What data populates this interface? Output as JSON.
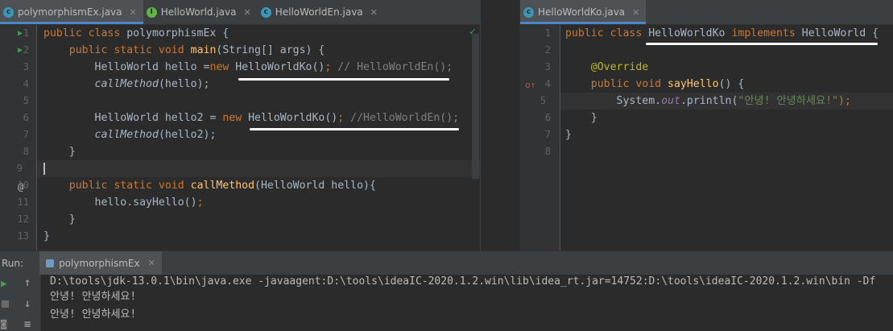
{
  "left_tabs": [
    {
      "label": "polymorphismEx.java",
      "icon": "class-icon",
      "active": true
    },
    {
      "label": "HelloWorld.java",
      "icon": "interface-icon",
      "active": false
    },
    {
      "label": "HelloWorldEn.java",
      "icon": "class-icon",
      "active": false
    }
  ],
  "right_tabs": [
    {
      "label": "HelloWorldKo.java",
      "icon": "class-icon",
      "active": true
    }
  ],
  "left_code": {
    "line_numbers": [
      "1",
      "2",
      "3",
      "4",
      "5",
      "6",
      "7",
      "8",
      "9",
      "10",
      "11",
      "12",
      "13"
    ],
    "l1": {
      "kw": "public class ",
      "name": "polymorphismEx {"
    },
    "l2": {
      "kw": "public static void ",
      "fn": "main",
      "rest": "(String[] args) {"
    },
    "l3": {
      "a": "HelloWorld hello =",
      "kw": "new ",
      "b": "HelloWorldKo()",
      "c": "; ",
      "cm": "// HelloWorldEn();"
    },
    "l4": {
      "it": "callMethod",
      "rest": "(hello);"
    },
    "l6": {
      "a": "HelloWorld hello2 = ",
      "kw": "new ",
      "b": "HelloWorldKo()",
      "c": "; ",
      "cm": "//HelloWorldEn();"
    },
    "l7": {
      "it": "callMethod",
      "rest": "(hello2);"
    },
    "l8": "}",
    "l10": {
      "kw": "public static void ",
      "fn": "callMethod",
      "rest": "(HelloWorld hello){"
    },
    "l11": {
      "a": "hello.sayHello()",
      "c": ";"
    },
    "l12": "}",
    "l13": "}"
  },
  "right_code": {
    "line_numbers": [
      "1",
      "2",
      "3",
      "4",
      "5",
      "6",
      "7",
      "8"
    ],
    "l1": {
      "kw": "public class ",
      "a": "HelloWorldKo ",
      "kw2": "implements ",
      "b": "HelloWorld {"
    },
    "l3": "@Override",
    "l4": {
      "kw": "public void ",
      "fn": "sayHello",
      "rest": "() {"
    },
    "l5": {
      "a": "System.",
      "it": "out",
      "b": ".println(",
      "str": "\"안녕! 안녕하세요!\"",
      "c": ");"
    },
    "l6": "}",
    "l7": "}"
  },
  "run": {
    "label": "Run:",
    "tab": "polymorphismEx"
  },
  "console": {
    "lines": [
      "D:\\tools\\jdk-13.0.1\\bin\\java.exe -javaagent:D:\\tools\\ideaIC-2020.1.2.win\\lib\\idea_rt.jar=14752:D:\\tools\\ideaIC-2020.1.2.win\\bin -Df",
      "안녕! 안녕하세요!",
      "안녕! 안녕하세요!"
    ]
  }
}
